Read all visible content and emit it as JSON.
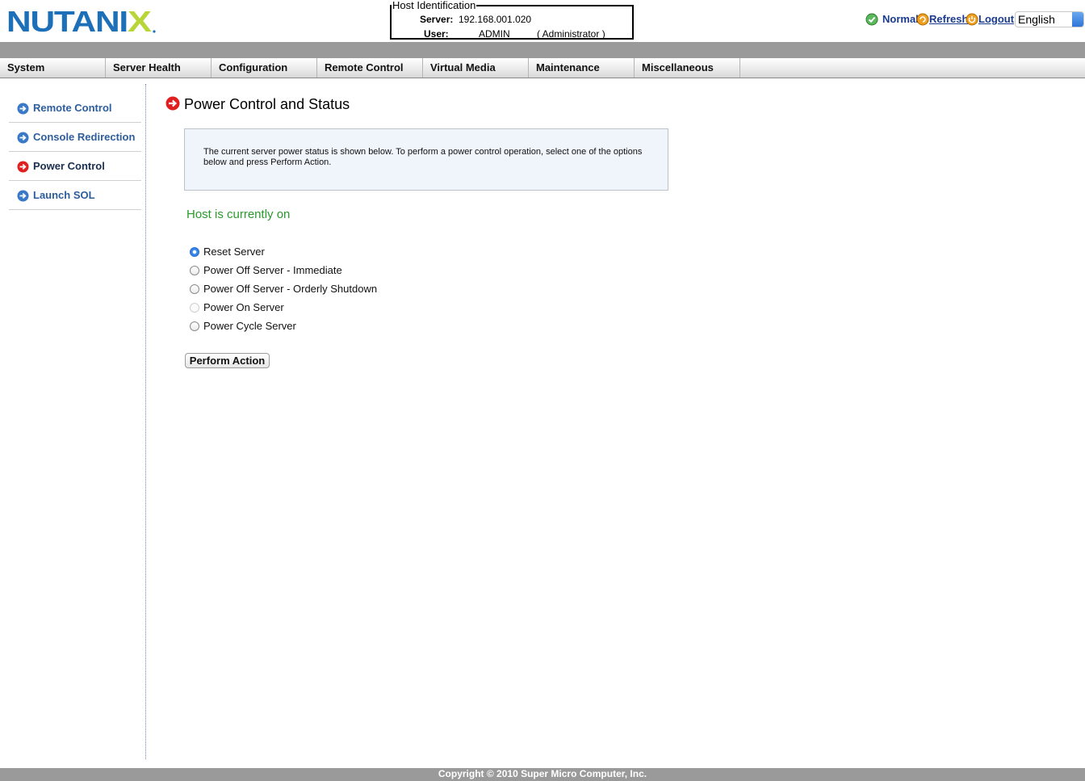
{
  "brand": {
    "logo_text": "NUTANIX",
    "logo_color": "#1d6fb8",
    "logo_x_color": "#b8d53a"
  },
  "host": {
    "legend": "Host Identification",
    "server_label": "Server:",
    "server_value": "192.168.001.020",
    "user_label": "User:",
    "user_value": "ADMIN",
    "user_role": "( Administrator )"
  },
  "top_right": {
    "status": "Normal",
    "refresh": "Refresh",
    "logout": "Logout",
    "language": "English",
    "status_icon": "check-circle-icon",
    "refresh_icon": "refresh-icon",
    "logout_icon": "logout-icon"
  },
  "nav": {
    "items": [
      {
        "label": "System"
      },
      {
        "label": "Server Health"
      },
      {
        "label": "Configuration"
      },
      {
        "label": "Remote Control"
      },
      {
        "label": "Virtual Media"
      },
      {
        "label": "Maintenance"
      },
      {
        "label": "Miscellaneous"
      }
    ]
  },
  "sidebar": {
    "items": [
      {
        "label": "Remote Control",
        "icon": "arrow-right-circle-icon",
        "active": false
      },
      {
        "label": "Console Redirection",
        "icon": "arrow-right-circle-icon",
        "active": false
      },
      {
        "label": "Power Control",
        "icon": "arrow-right-circle-icon",
        "active": true
      },
      {
        "label": "Launch SOL",
        "icon": "arrow-right-circle-icon",
        "active": false
      }
    ]
  },
  "main": {
    "title": "Power Control and Status",
    "info": "The current server power status is shown below. To perform a power control operation, select one of the options below and press Perform Action.",
    "host_status": "Host is currently on",
    "options": [
      {
        "label": "Reset Server",
        "checked": true,
        "disabled": false
      },
      {
        "label": "Power Off Server - Immediate",
        "checked": false,
        "disabled": false
      },
      {
        "label": "Power Off Server - Orderly Shutdown",
        "checked": false,
        "disabled": false
      },
      {
        "label": "Power On Server",
        "checked": false,
        "disabled": true
      },
      {
        "label": "Power Cycle Server",
        "checked": false,
        "disabled": false
      }
    ],
    "perform_button": "Perform Action"
  },
  "footer": {
    "copyright": "Copyright © 2010 Super Micro Computer, Inc."
  },
  "colors": {
    "accent_blue": "#2d5d9c",
    "status_green": "#2a9a2a",
    "active_icon_red": "#e02020",
    "band_gray": "#9a9a9a"
  }
}
